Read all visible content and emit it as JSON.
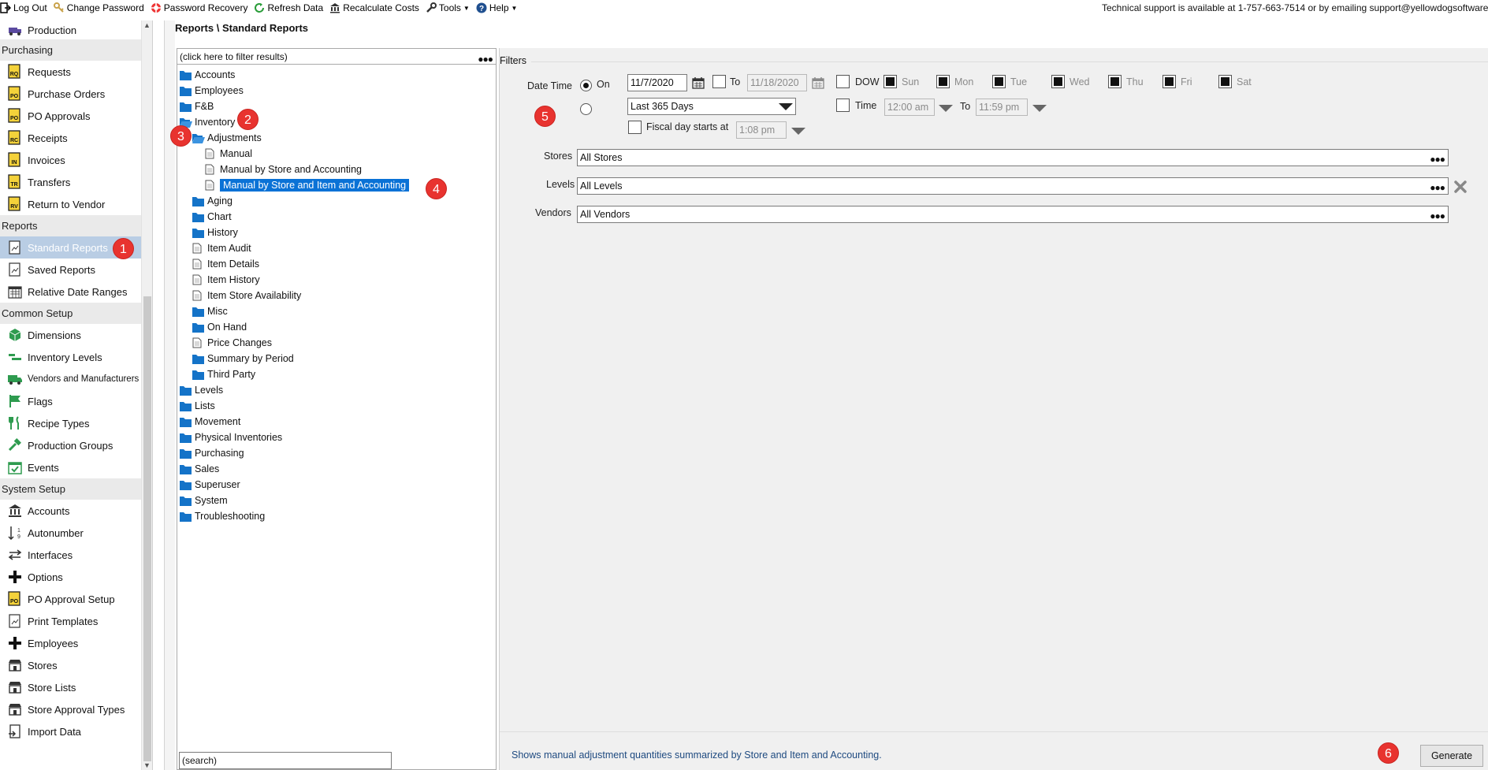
{
  "topbar": {
    "items": [
      {
        "label": "Log Out"
      },
      {
        "label": "Change Password"
      },
      {
        "label": "Password Recovery"
      },
      {
        "label": "Refresh Data"
      },
      {
        "label": "Recalculate Costs"
      },
      {
        "label": "Tools"
      },
      {
        "label": "Help"
      }
    ],
    "support": "Technical support is available at 1-757-663-7514 or by emailing support@yellowdogsoftware.c"
  },
  "sidebar": {
    "top_item": "Production",
    "sections": [
      {
        "title": "Purchasing",
        "items": [
          "Requests",
          "Purchase Orders",
          "PO Approvals",
          "Receipts",
          "Invoices",
          "Transfers",
          "Return to Vendor"
        ]
      },
      {
        "title": "Reports",
        "items": [
          "Standard Reports",
          "Saved Reports",
          "Relative Date Ranges"
        ]
      },
      {
        "title": "Common Setup",
        "items": [
          "Dimensions",
          "Inventory Levels",
          "Vendors and Manufacturers",
          "Flags",
          "Recipe Types",
          "Production Groups",
          "Events"
        ]
      },
      {
        "title": "System Setup",
        "items": [
          "Accounts",
          "Autonumber",
          "Interfaces",
          "Options",
          "PO Approval Setup",
          "Print Templates",
          "Employees",
          "Stores",
          "Store Lists",
          "Store Approval Types",
          "Import Data"
        ]
      }
    ],
    "active_item": "Standard Reports"
  },
  "breadcrumb": "Reports \\ Standard Reports",
  "tree": {
    "filter_placeholder": "(click here to filter results)",
    "search_placeholder": "(search)",
    "nodes": [
      {
        "label": "Accounts",
        "type": "folder",
        "depth": 0
      },
      {
        "label": "Employees",
        "type": "folder",
        "depth": 0
      },
      {
        "label": "F&B",
        "type": "folder",
        "depth": 0
      },
      {
        "label": "Inventory",
        "type": "folder-open",
        "depth": 0
      },
      {
        "label": "Adjustments",
        "type": "folder-open",
        "depth": 1
      },
      {
        "label": "Manual",
        "type": "report",
        "depth": 2
      },
      {
        "label": "Manual by Store and Accounting",
        "type": "report",
        "depth": 2
      },
      {
        "label": "Manual by Store and Item and Accounting",
        "type": "report",
        "depth": 2,
        "selected": true
      },
      {
        "label": "Aging",
        "type": "folder",
        "depth": 1
      },
      {
        "label": "Chart",
        "type": "folder",
        "depth": 1
      },
      {
        "label": "History",
        "type": "folder",
        "depth": 1
      },
      {
        "label": "Item Audit",
        "type": "report",
        "depth": 1
      },
      {
        "label": "Item Details",
        "type": "report",
        "depth": 1
      },
      {
        "label": "Item History",
        "type": "report",
        "depth": 1
      },
      {
        "label": "Item Store Availability",
        "type": "report",
        "depth": 1
      },
      {
        "label": "Misc",
        "type": "folder",
        "depth": 1
      },
      {
        "label": "On Hand",
        "type": "folder",
        "depth": 1
      },
      {
        "label": "Price Changes",
        "type": "report",
        "depth": 1
      },
      {
        "label": "Summary by Period",
        "type": "folder",
        "depth": 1
      },
      {
        "label": "Third Party",
        "type": "folder",
        "depth": 1
      },
      {
        "label": "Levels",
        "type": "folder",
        "depth": 0
      },
      {
        "label": "Lists",
        "type": "folder",
        "depth": 0
      },
      {
        "label": "Movement",
        "type": "folder",
        "depth": 0
      },
      {
        "label": "Physical Inventories",
        "type": "folder",
        "depth": 0
      },
      {
        "label": "Purchasing",
        "type": "folder",
        "depth": 0
      },
      {
        "label": "Sales",
        "type": "folder",
        "depth": 0
      },
      {
        "label": "Superuser",
        "type": "folder",
        "depth": 0
      },
      {
        "label": "System",
        "type": "folder",
        "depth": 0
      },
      {
        "label": "Troubleshooting",
        "type": "folder",
        "depth": 0
      }
    ]
  },
  "filters": {
    "title": "Filters",
    "date_time_label": "Date Time",
    "on_label": "On",
    "on_date": "11/7/2020",
    "to_label": "To",
    "to_date": "11/18/2020",
    "dow_label": "DOW",
    "days": [
      "Sun",
      "Mon",
      "Tue",
      "Wed",
      "Thu",
      "Fri",
      "Sat"
    ],
    "range_value": "Last 365 Days",
    "time_label": "Time",
    "time_from": "12:00 am",
    "time_to_label": "To",
    "time_to": "11:59 pm",
    "fiscal_label": "Fiscal day starts at",
    "fiscal_time": "1:08 pm",
    "stores_label": "Stores",
    "stores_value": "All Stores",
    "levels_label": "Levels",
    "levels_value": "All Levels",
    "vendors_label": "Vendors",
    "vendors_value": "All Vendors"
  },
  "description": "Shows manual adjustment quantities summarized by Store and Item and Accounting.",
  "generate_label": "Generate",
  "callouts": [
    "1",
    "2",
    "3",
    "4",
    "5",
    "6"
  ],
  "colors": {
    "accent": "#0a72d6",
    "callout": "#e8332f",
    "active_nav": "#b9cde4"
  }
}
